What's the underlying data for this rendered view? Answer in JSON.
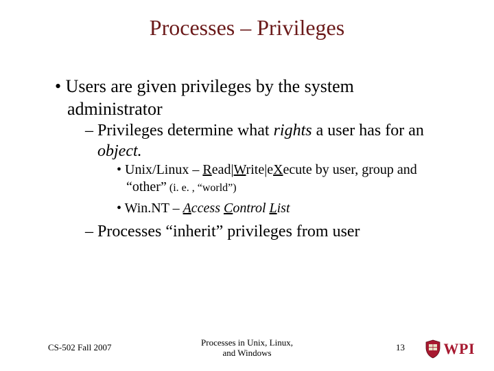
{
  "title": "Processes – Privileges",
  "bullets": {
    "b1": "Users are given privileges by the system administrator",
    "b1a_pre": "Privileges determine what ",
    "b1a_em1": "rights",
    "b1a_mid": " a user has for an ",
    "b1a_em2": "object.",
    "b1a1_pre": "Unix/Linux – ",
    "b1a1_R": "R",
    "b1a1_read": "ead|",
    "b1a1_W": "W",
    "b1a1_write": "rite|e",
    "b1a1_X": "X",
    "b1a1_rest": "ecute by user, group and “other”",
    "b1a1_small": " (i. e. , “world”)",
    "b1a2_pre": "Win.NT – ",
    "b1a2_A": "A",
    "b1a2_a": "ccess ",
    "b1a2_C": "C",
    "b1a2_c": "ontrol ",
    "b1a2_L": "L",
    "b1a2_l": "ist",
    "b1b": "Processes “inherit” privileges from user"
  },
  "footer": {
    "left": "CS-502 Fall 2007",
    "center1": "Processes in Unix, Linux,",
    "center2": "and Windows",
    "page": "13",
    "logo_text": "WPI"
  },
  "colors": {
    "title": "#6b1a1a",
    "logo": "#a71930"
  }
}
